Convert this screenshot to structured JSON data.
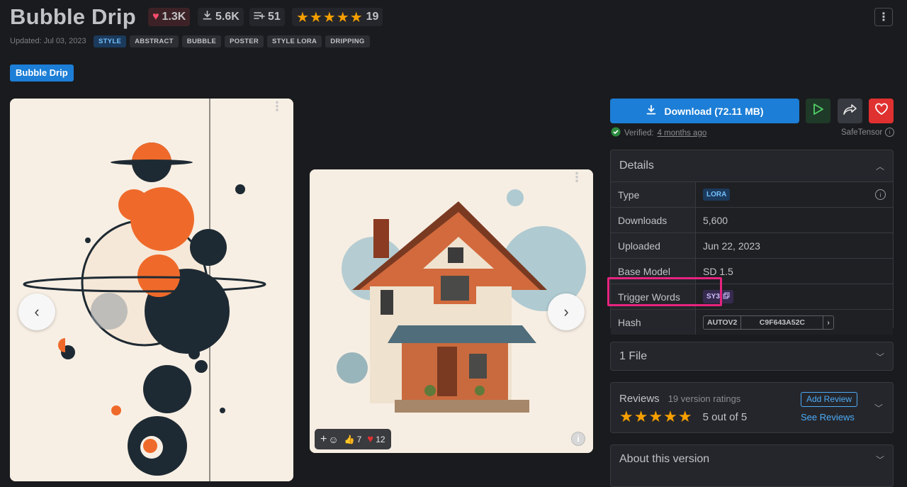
{
  "header": {
    "title": "Bubble Drip",
    "likes": "1.3K",
    "downloads": "5.6K",
    "comments": "51",
    "rating_stars": "★★★★★",
    "rating_count": "19",
    "updated": "Updated: Jul 03, 2023",
    "tags": [
      "STYLE",
      "ABSTRACT",
      "BUBBLE",
      "POSTER",
      "STYLE LORA",
      "DRIPPING"
    ]
  },
  "version_button": "Bubble Drip",
  "gallery": {
    "reactions": {
      "add": "+",
      "thumbs": "7",
      "hearts": "12"
    }
  },
  "actions": {
    "download_label": "Download (72.11 MB)",
    "verified_label": "Verified:",
    "verified_when": "4 months ago",
    "safetensor": "SafeTensor"
  },
  "details": {
    "heading": "Details",
    "rows": {
      "type_label": "Type",
      "type_value": "LORA",
      "downloads_label": "Downloads",
      "downloads_value": "5,600",
      "uploaded_label": "Uploaded",
      "uploaded_value": "Jun 22, 2023",
      "base_label": "Base Model",
      "base_value": "SD 1.5",
      "trigger_label": "Trigger Words",
      "trigger_value": "SY3",
      "hash_label": "Hash",
      "hash_type": "AUTOV2",
      "hash_value": "C9F643A52C"
    }
  },
  "files": {
    "label": "1 File"
  },
  "reviews": {
    "label": "Reviews",
    "ratings": "19 version ratings",
    "stars": "★★★★★",
    "score": "5 out of 5",
    "add": "Add Review",
    "see": "See Reviews"
  },
  "about": {
    "label": "About this version"
  },
  "colors": {
    "background": "#1a1b1e",
    "primary": "#1c7ed6",
    "star": "#f59f00",
    "danger": "#e03131",
    "highlight": "#e6247f"
  }
}
